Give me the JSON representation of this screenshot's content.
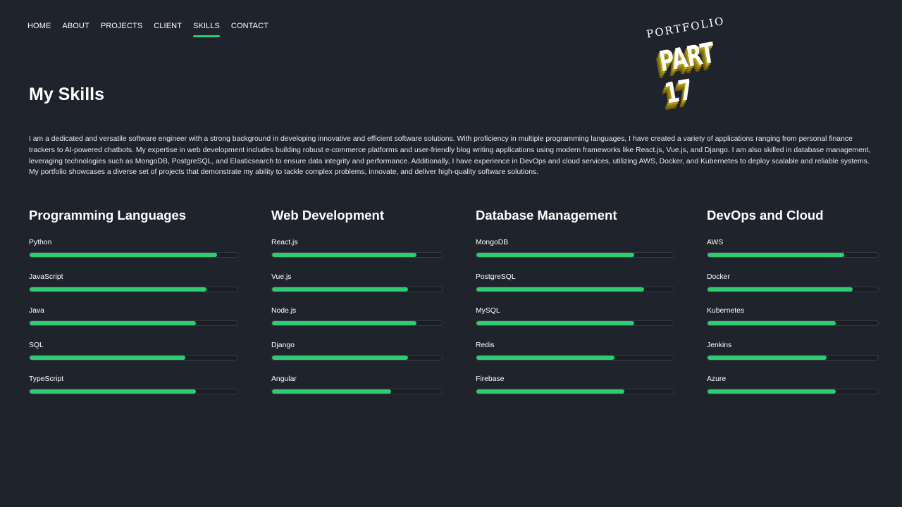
{
  "nav": {
    "items": [
      {
        "label": "HOME",
        "active": false
      },
      {
        "label": "ABOUT",
        "active": false
      },
      {
        "label": "PROJECTS",
        "active": false
      },
      {
        "label": "CLIENT",
        "active": false
      },
      {
        "label": "SKILLS",
        "active": true
      },
      {
        "label": "CONTACT",
        "active": false
      }
    ]
  },
  "logo": {
    "small_text": "PORTFOLIO",
    "big_text": "PART 17"
  },
  "page": {
    "title": "My Skills",
    "intro": "I am a dedicated and versatile software engineer with a strong background in developing innovative and efficient software solutions. With proficiency in multiple programming languages, I have created a variety of applications ranging from personal finance trackers to AI-powered chatbots. My expertise in web development includes building robust e-commerce platforms and user-friendly blog writing applications using modern frameworks like React.js, Vue.js, and Django. I am also skilled in database management, leveraging technologies such as MongoDB, PostgreSQL, and Elasticsearch to ensure data integrity and performance. Additionally, I have experience in DevOps and cloud services, utilizing AWS, Docker, and Kubernetes to deploy scalable and reliable systems. My portfolio showcases a diverse set of projects that demonstrate my ability to tackle complex problems, innovate, and deliver high-quality software solutions."
  },
  "colors": {
    "background": "#1f232b",
    "accent": "#2ecc71"
  },
  "categories": [
    {
      "title": "Programming Languages",
      "skills": [
        {
          "name": "Python",
          "level": 0.9
        },
        {
          "name": "JavaScript",
          "level": 0.85
        },
        {
          "name": "Java",
          "level": 0.8
        },
        {
          "name": "SQL",
          "level": 0.75
        },
        {
          "name": "TypeScript",
          "level": 0.8
        }
      ]
    },
    {
      "title": "Web Development",
      "skills": [
        {
          "name": "React.js",
          "level": 0.85
        },
        {
          "name": "Vue.js",
          "level": 0.8
        },
        {
          "name": "Node.js",
          "level": 0.85
        },
        {
          "name": "Django",
          "level": 0.8
        },
        {
          "name": "Angular",
          "level": 0.7
        }
      ]
    },
    {
      "title": "Database Management",
      "skills": [
        {
          "name": "MongoDB",
          "level": 0.8
        },
        {
          "name": "PostgreSQL",
          "level": 0.85
        },
        {
          "name": "MySQL",
          "level": 0.8
        },
        {
          "name": "Redis",
          "level": 0.7
        },
        {
          "name": "Firebase",
          "level": 0.75
        }
      ]
    },
    {
      "title": "DevOps and Cloud",
      "skills": [
        {
          "name": "AWS",
          "level": 0.8
        },
        {
          "name": "Docker",
          "level": 0.85
        },
        {
          "name": "Kubernetes",
          "level": 0.75
        },
        {
          "name": "Jenkins",
          "level": 0.7
        },
        {
          "name": "Azure",
          "level": 0.75
        }
      ]
    }
  ]
}
